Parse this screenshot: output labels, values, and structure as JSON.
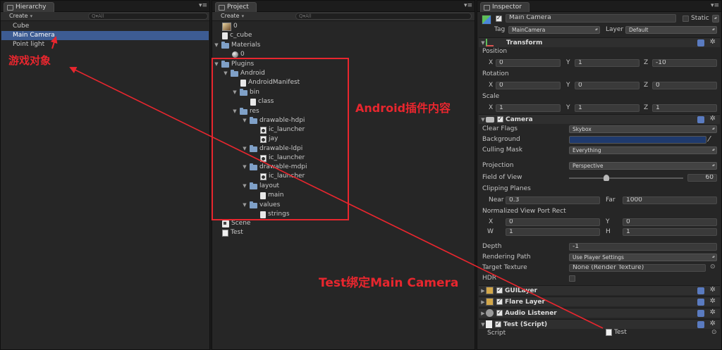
{
  "hierarchy": {
    "tab": "Hierarchy",
    "create_label": "Create",
    "search_placeholder": "Q▾All",
    "items": [
      "Cube",
      "Main Camera",
      "Point light"
    ]
  },
  "project": {
    "tab": "Project",
    "create_label": "Create",
    "search_placeholder": "Q▾All",
    "tree": {
      "n0": "0",
      "c_cube": "c_cube",
      "materials": "Materials",
      "mat0": "0",
      "plugins": "Plugins",
      "android": "Android",
      "manifest": "AndroidManifest",
      "bin": "bin",
      "class": "class",
      "res": "res",
      "hdpi": "drawable-hdpi",
      "hdpi_ic": "ic_launcher",
      "hdpi_jay": "jay",
      "ldpi": "drawable-ldpi",
      "ldpi_ic": "ic_launcher",
      "mdpi": "drawable-mdpi",
      "mdpi_ic": "ic_launcher",
      "layout": "layout",
      "main": "main",
      "values": "values",
      "strings": "strings",
      "scene": "Scene",
      "test": "Test"
    }
  },
  "inspector": {
    "tab": "Inspector",
    "object_name": "Main Camera",
    "static_label": "Static",
    "tag_label": "Tag",
    "tag_value": "MainCamera",
    "layer_label": "Layer",
    "layer_value": "Default",
    "transform": {
      "title": "Transform",
      "position_label": "Position",
      "rotation_label": "Rotation",
      "scale_label": "Scale",
      "x_label": "X",
      "y_label": "Y",
      "z_label": "Z",
      "position": [
        "0",
        "1",
        "-10"
      ],
      "rotation": [
        "0",
        "0",
        "0"
      ],
      "scale": [
        "1",
        "1",
        "1"
      ]
    },
    "camera": {
      "title": "Camera",
      "clear_flags_label": "Clear Flags",
      "clear_flags_value": "Skybox",
      "background_label": "Background",
      "background_color": "#1f3a6e",
      "culling_mask_label": "Culling Mask",
      "culling_mask_value": "Everything",
      "projection_label": "Projection",
      "projection_value": "Perspective",
      "fov_label": "Field of View",
      "fov_value": "60",
      "fov_fraction": 0.33,
      "clipping_label": "Clipping Planes",
      "near_label": "Near",
      "near_value": "0.3",
      "far_label": "Far",
      "far_value": "1000",
      "viewport_label": "Normalized View Port Rect",
      "x_label": "X",
      "y_label": "Y",
      "w_label": "W",
      "h_label": "H",
      "x_value": "0",
      "y_value": "0",
      "w_value": "1",
      "h_value": "1",
      "depth_label": "Depth",
      "depth_value": "-1",
      "rendering_path_label": "Rendering Path",
      "rendering_path_value": "Use Player Settings",
      "target_texture_label": "Target Texture",
      "target_texture_value": "None (Render Texture)",
      "hdr_label": "HDR"
    },
    "gui_layer": "GUILayer",
    "flare_layer": "Flare Layer",
    "audio_listener": "Audio Listener",
    "test_script": {
      "title": "Test (Script)",
      "script_label": "Script",
      "script_value": "Test"
    }
  },
  "annotations": {
    "game_objects": "游戏对象",
    "android_plugins": "Android插件内容",
    "test_binding": "Test绑定Main Camera",
    "color": "#e8262e"
  }
}
